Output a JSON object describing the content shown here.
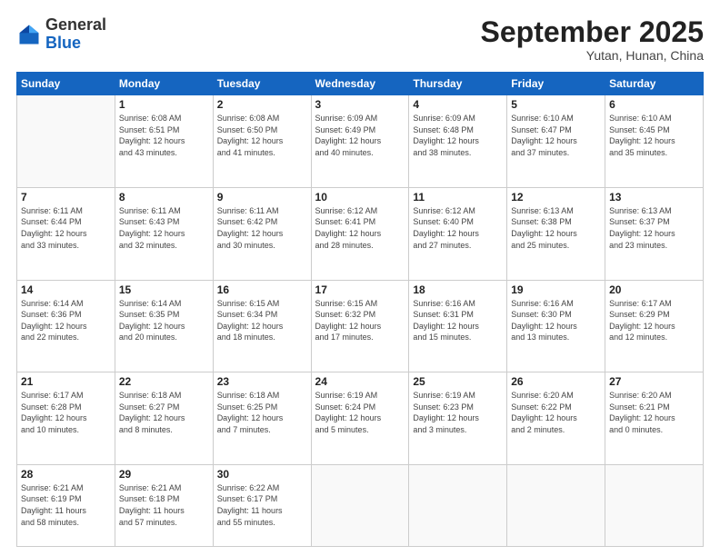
{
  "header": {
    "logo_general": "General",
    "logo_blue": "Blue",
    "month_title": "September 2025",
    "location": "Yutan, Hunan, China"
  },
  "weekdays": [
    "Sunday",
    "Monday",
    "Tuesday",
    "Wednesday",
    "Thursday",
    "Friday",
    "Saturday"
  ],
  "weeks": [
    [
      {
        "day": "",
        "info": ""
      },
      {
        "day": "1",
        "info": "Sunrise: 6:08 AM\nSunset: 6:51 PM\nDaylight: 12 hours\nand 43 minutes."
      },
      {
        "day": "2",
        "info": "Sunrise: 6:08 AM\nSunset: 6:50 PM\nDaylight: 12 hours\nand 41 minutes."
      },
      {
        "day": "3",
        "info": "Sunrise: 6:09 AM\nSunset: 6:49 PM\nDaylight: 12 hours\nand 40 minutes."
      },
      {
        "day": "4",
        "info": "Sunrise: 6:09 AM\nSunset: 6:48 PM\nDaylight: 12 hours\nand 38 minutes."
      },
      {
        "day": "5",
        "info": "Sunrise: 6:10 AM\nSunset: 6:47 PM\nDaylight: 12 hours\nand 37 minutes."
      },
      {
        "day": "6",
        "info": "Sunrise: 6:10 AM\nSunset: 6:45 PM\nDaylight: 12 hours\nand 35 minutes."
      }
    ],
    [
      {
        "day": "7",
        "info": "Sunrise: 6:11 AM\nSunset: 6:44 PM\nDaylight: 12 hours\nand 33 minutes."
      },
      {
        "day": "8",
        "info": "Sunrise: 6:11 AM\nSunset: 6:43 PM\nDaylight: 12 hours\nand 32 minutes."
      },
      {
        "day": "9",
        "info": "Sunrise: 6:11 AM\nSunset: 6:42 PM\nDaylight: 12 hours\nand 30 minutes."
      },
      {
        "day": "10",
        "info": "Sunrise: 6:12 AM\nSunset: 6:41 PM\nDaylight: 12 hours\nand 28 minutes."
      },
      {
        "day": "11",
        "info": "Sunrise: 6:12 AM\nSunset: 6:40 PM\nDaylight: 12 hours\nand 27 minutes."
      },
      {
        "day": "12",
        "info": "Sunrise: 6:13 AM\nSunset: 6:38 PM\nDaylight: 12 hours\nand 25 minutes."
      },
      {
        "day": "13",
        "info": "Sunrise: 6:13 AM\nSunset: 6:37 PM\nDaylight: 12 hours\nand 23 minutes."
      }
    ],
    [
      {
        "day": "14",
        "info": "Sunrise: 6:14 AM\nSunset: 6:36 PM\nDaylight: 12 hours\nand 22 minutes."
      },
      {
        "day": "15",
        "info": "Sunrise: 6:14 AM\nSunset: 6:35 PM\nDaylight: 12 hours\nand 20 minutes."
      },
      {
        "day": "16",
        "info": "Sunrise: 6:15 AM\nSunset: 6:34 PM\nDaylight: 12 hours\nand 18 minutes."
      },
      {
        "day": "17",
        "info": "Sunrise: 6:15 AM\nSunset: 6:32 PM\nDaylight: 12 hours\nand 17 minutes."
      },
      {
        "day": "18",
        "info": "Sunrise: 6:16 AM\nSunset: 6:31 PM\nDaylight: 12 hours\nand 15 minutes."
      },
      {
        "day": "19",
        "info": "Sunrise: 6:16 AM\nSunset: 6:30 PM\nDaylight: 12 hours\nand 13 minutes."
      },
      {
        "day": "20",
        "info": "Sunrise: 6:17 AM\nSunset: 6:29 PM\nDaylight: 12 hours\nand 12 minutes."
      }
    ],
    [
      {
        "day": "21",
        "info": "Sunrise: 6:17 AM\nSunset: 6:28 PM\nDaylight: 12 hours\nand 10 minutes."
      },
      {
        "day": "22",
        "info": "Sunrise: 6:18 AM\nSunset: 6:27 PM\nDaylight: 12 hours\nand 8 minutes."
      },
      {
        "day": "23",
        "info": "Sunrise: 6:18 AM\nSunset: 6:25 PM\nDaylight: 12 hours\nand 7 minutes."
      },
      {
        "day": "24",
        "info": "Sunrise: 6:19 AM\nSunset: 6:24 PM\nDaylight: 12 hours\nand 5 minutes."
      },
      {
        "day": "25",
        "info": "Sunrise: 6:19 AM\nSunset: 6:23 PM\nDaylight: 12 hours\nand 3 minutes."
      },
      {
        "day": "26",
        "info": "Sunrise: 6:20 AM\nSunset: 6:22 PM\nDaylight: 12 hours\nand 2 minutes."
      },
      {
        "day": "27",
        "info": "Sunrise: 6:20 AM\nSunset: 6:21 PM\nDaylight: 12 hours\nand 0 minutes."
      }
    ],
    [
      {
        "day": "28",
        "info": "Sunrise: 6:21 AM\nSunset: 6:19 PM\nDaylight: 11 hours\nand 58 minutes."
      },
      {
        "day": "29",
        "info": "Sunrise: 6:21 AM\nSunset: 6:18 PM\nDaylight: 11 hours\nand 57 minutes."
      },
      {
        "day": "30",
        "info": "Sunrise: 6:22 AM\nSunset: 6:17 PM\nDaylight: 11 hours\nand 55 minutes."
      },
      {
        "day": "",
        "info": ""
      },
      {
        "day": "",
        "info": ""
      },
      {
        "day": "",
        "info": ""
      },
      {
        "day": "",
        "info": ""
      }
    ]
  ]
}
